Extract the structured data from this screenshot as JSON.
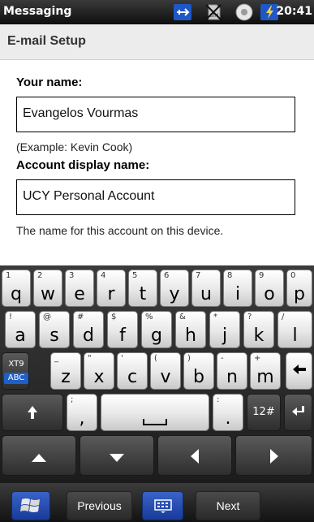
{
  "status_bar": {
    "app_name": "Messaging",
    "time": "20:41",
    "icons": [
      "usb-sync-icon",
      "no-sim-icon",
      "sound-icon",
      "battery-charging-icon"
    ]
  },
  "header": {
    "title": "E-mail Setup"
  },
  "form": {
    "name_label": "Your name:",
    "name_value": "Evangelos Vourmas",
    "name_example": "(Example: Kevin Cook)",
    "display_label": "Account display name:",
    "display_value": "UCY Personal Account",
    "display_help": "The name for this account on this device."
  },
  "keyboard": {
    "row1": [
      {
        "main": "q",
        "alt": "1"
      },
      {
        "main": "w",
        "alt": "2"
      },
      {
        "main": "e",
        "alt": "3"
      },
      {
        "main": "r",
        "alt": "4"
      },
      {
        "main": "t",
        "alt": "5"
      },
      {
        "main": "y",
        "alt": "6"
      },
      {
        "main": "u",
        "alt": "7"
      },
      {
        "main": "i",
        "alt": "8"
      },
      {
        "main": "o",
        "alt": "9"
      },
      {
        "main": "p",
        "alt": "0"
      }
    ],
    "row2": [
      {
        "main": "a",
        "alt": "!"
      },
      {
        "main": "s",
        "alt": "@"
      },
      {
        "main": "d",
        "alt": "#"
      },
      {
        "main": "f",
        "alt": "$"
      },
      {
        "main": "g",
        "alt": "%"
      },
      {
        "main": "h",
        "alt": "&"
      },
      {
        "main": "j",
        "alt": "*"
      },
      {
        "main": "k",
        "alt": "?"
      },
      {
        "main": "l",
        "alt": "/"
      }
    ],
    "row3": [
      {
        "main": "z",
        "alt": "_"
      },
      {
        "main": "x",
        "alt": "\""
      },
      {
        "main": "c",
        "alt": "'"
      },
      {
        "main": "v",
        "alt": "("
      },
      {
        "main": "b",
        "alt": ")"
      },
      {
        "main": "n",
        "alt": "-"
      },
      {
        "main": "m",
        "alt": "+"
      }
    ],
    "xt9_label": "XT9",
    "abc_label": "ABC",
    "comma_key": {
      "main": ",",
      "alt": ";"
    },
    "period_key": {
      "main": ".",
      "alt": ":"
    },
    "num_key_label": "12#"
  },
  "taskbar": {
    "previous_label": "Previous",
    "next_label": "Next"
  },
  "colors": {
    "accent": "#1f5fc9",
    "status_bar": "#1a1a1a"
  }
}
